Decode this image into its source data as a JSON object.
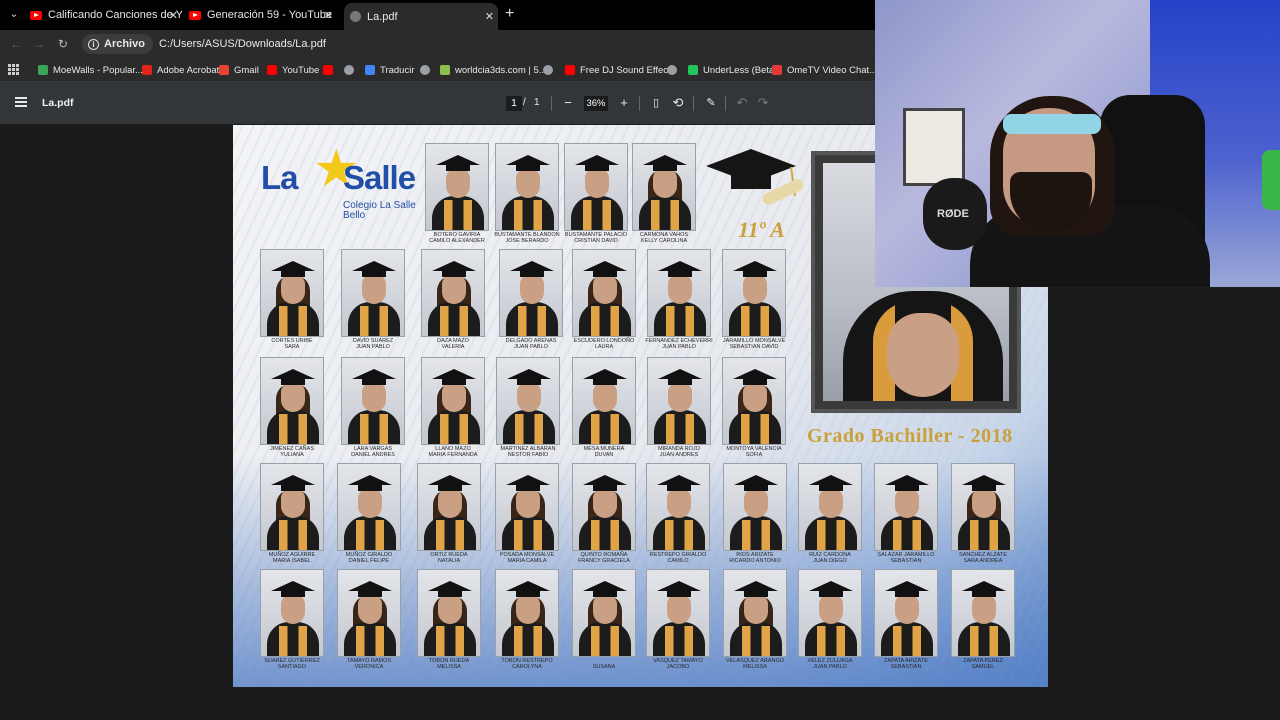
{
  "tabs": [
    {
      "title": "Calificando Canciones de YouTube",
      "favicon": "youtube-icon",
      "active": false
    },
    {
      "title": "Generación 59 - YouTube",
      "favicon": "youtube-icon",
      "active": false
    },
    {
      "title": "La.pdf",
      "favicon": "globe-icon",
      "active": true
    }
  ],
  "address": {
    "chip_label": "Archivo",
    "url": "C:/Users/ASUS/Downloads/La.pdf"
  },
  "bookmarks": [
    {
      "label": "MoeWalls - Popular...",
      "color": "#3aa757"
    },
    {
      "label": "Adobe Acrobat",
      "color": "#e0261b"
    },
    {
      "label": "Gmail",
      "color": "#ea4335"
    },
    {
      "label": "YouTube",
      "color": "#ff0000"
    },
    {
      "label": "",
      "color": "#ff0000"
    },
    {
      "label": "",
      "color": "#9aa0a6"
    },
    {
      "label": "Traducir",
      "color": "#4285f4"
    },
    {
      "label": "",
      "color": "#9aa0a6"
    },
    {
      "label": "worldcia3ds.com | 5...",
      "color": "#8bc34a"
    },
    {
      "label": "",
      "color": "#9aa0a6"
    },
    {
      "label": "Free DJ Sound Effec...",
      "color": "#ff0000"
    },
    {
      "label": "",
      "color": "#9aa0a6"
    },
    {
      "label": "UnderLess (Beta)",
      "color": "#21c45d"
    },
    {
      "label": "OmeTV Video Chat...",
      "color": "#e53935"
    }
  ],
  "pdf": {
    "title": "La.pdf",
    "page_current": "1",
    "page_sep": "/",
    "page_total": "1",
    "zoom": "36%"
  },
  "yearbook": {
    "logo_word_left": "La",
    "logo_word_right": "Salle",
    "logo_sub": "Colegio La Salle\nBello",
    "class_title": "11º A",
    "grado": "Grado Bachiller - 2018",
    "students": [
      [
        "BOTERO GAVIRIA\nCAMILO ALEXANDER",
        "BUSTAMANTE BLANDON\nJOSE BERARDO",
        "BUSTAMANTE PALACIO\nCRISTIAN DAVID",
        "CARMONA VAHOS\nKELLY CAROLINA"
      ],
      [
        "CORTES URIBE\nSARA",
        "DAVID SUAREZ\nJUAN PABLO",
        "DAZA MAZO\nVALERIA",
        "DELGADO ARENAS\nJUAN PABLO",
        "ESCUDERO LONDOÑO\nLAURA",
        "FERNANDEZ ECHEVERRI\nJUAN PABLO",
        "JARAMILLO MONSALVE\nSEBASTIAN DAVID"
      ],
      [
        "JIMENEZ CAÑAS\nYULIANA",
        "LARA VARGAS\nDANIEL ANDRES",
        "LLANO MAZO\nMARIA FERNANDA",
        "MARTINEZ ALBARAN\nNESTOR FABIO",
        "MESA MUNERA\nDUVAN",
        "MIRANDA ROJO\nJUAN ANDRES",
        "MONTOYA VALENCIA\nSOFIA"
      ],
      [
        "MUÑOZ AGUIRRE\nMARIA ISABEL",
        "MUÑOZ GIRALDO\nDANIEL FELIPE",
        "ORTIZ RUEDA\nNATALIA",
        "POSADA MONSALVE\nMARIA CAMILA",
        "QUINTO ROMAÑA\nFRANCY GRACIELA",
        "RESTREPO GIRALDO\nCAMILO",
        "RIOS ARIZATE\nRICARDO ANTONIO",
        "RUIZ CARDONA\nJUAN DIEGO",
        "SALAZAR JARAMILLO\nSEBASTIAN",
        "SANCHEZ ALZATE\nSARA ANDREA"
      ],
      [
        "SUAREZ GUTIERREZ\nSANTIAGO",
        "TAMAYO RAMOS\nVERONICA",
        "TOBON RUEDA\nMELISSA",
        "TOBON RESTREPO\nCAROLYNA",
        "\nSUSANA",
        "VASQUEZ TAMAYO\nJACOBO",
        "VELASQUEZ ARANGO\nMELISSA",
        "VELEZ ZULUAGA\nJUAN PABLO",
        "ZAPATA ARIZATE\nSEBASTIAN",
        "ZAPATA PEREZ\nSAMUEL"
      ]
    ]
  },
  "webcam": {
    "mic_brand": "RØDE"
  },
  "colors": {
    "tabstrip_bg": "#000000",
    "toolbar_bg": "#2b2b2b",
    "pdf_toolbar_bg": "#323639",
    "viewer_bg": "#1b1b1b",
    "accent_gold": "#caa03a",
    "logo_blue": "#1f4fa6"
  }
}
